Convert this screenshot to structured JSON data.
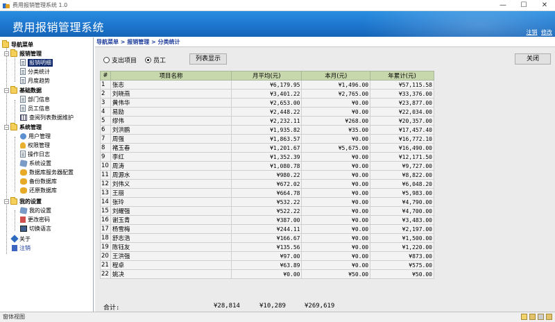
{
  "window": {
    "title": "费用报销管理系统 1.0",
    "controls": {
      "minimize": "—",
      "maximize": "☐",
      "close": "✕"
    }
  },
  "banner": {
    "title": "费用报销管理系统",
    "links": [
      "注销",
      "修改"
    ]
  },
  "sidebar": {
    "root": "导航菜单",
    "groups": [
      {
        "label": "报销管理",
        "items": [
          "报销明细",
          "分类统计",
          "月度趋势"
        ]
      },
      {
        "label": "基础数据",
        "items": [
          "部门信息",
          "员工信息",
          "查阅列表数据维护"
        ]
      },
      {
        "label": "系统管理",
        "items": [
          "用户管理",
          "权限管理",
          "操作日志",
          "系统设置",
          "数据库服务器配置",
          "备份数据库",
          "还原数据库"
        ]
      },
      {
        "label": "我的设置",
        "items": [
          "我的设置",
          "更改密码",
          "切换语言"
        ]
      }
    ],
    "about": "关于",
    "logout": "注销",
    "selected": "报销明细"
  },
  "breadcrumb": "导航菜单 > 报销管理 > 分类统计",
  "toolbar": {
    "radio_expense": "支出项目",
    "radio_employee": "员工",
    "list_button": "列表显示",
    "close_button": "关闭"
  },
  "table": {
    "headers": [
      "#",
      "项目名称",
      "月平均(元)",
      "本月(元)",
      "年累计(元)"
    ],
    "rows": [
      [
        "1",
        "张志",
        "¥6,179.95",
        "¥1,496.00",
        "¥57,115.58"
      ],
      [
        "2",
        "刘晓燕",
        "¥3,401.22",
        "¥2,765.00",
        "¥33,376.00"
      ],
      [
        "3",
        "黄伟华",
        "¥2,653.00",
        "¥0.00",
        "¥23,877.00"
      ],
      [
        "4",
        "易励",
        "¥2,448.22",
        "¥0.00",
        "¥22,034.00"
      ],
      [
        "5",
        "缪伟",
        "¥2,232.11",
        "¥268.00",
        "¥20,357.00"
      ],
      [
        "6",
        "刘洪鹏",
        "¥1,935.82",
        "¥35.00",
        "¥17,457.40"
      ],
      [
        "7",
        "周强",
        "¥1,863.57",
        "¥0.00",
        "¥16,772.10"
      ],
      [
        "8",
        "褚玉春",
        "¥1,201.67",
        "¥5,675.00",
        "¥16,490.00"
      ],
      [
        "9",
        "李红",
        "¥1,352.39",
        "¥0.00",
        "¥12,171.50"
      ],
      [
        "10",
        "周涛",
        "¥1,080.78",
        "¥0.00",
        "¥9,727.00"
      ],
      [
        "11",
        "周源水",
        "¥980.22",
        "¥0.00",
        "¥8,822.00"
      ],
      [
        "12",
        "刘伟义",
        "¥672.02",
        "¥0.00",
        "¥6,048.20"
      ],
      [
        "13",
        "王丽",
        "¥664.78",
        "¥0.00",
        "¥5,983.00"
      ],
      [
        "14",
        "张玲",
        "¥532.22",
        "¥0.00",
        "¥4,790.00"
      ],
      [
        "15",
        "刘耀强",
        "¥522.22",
        "¥0.00",
        "¥4,700.00"
      ],
      [
        "16",
        "谢玉青",
        "¥387.00",
        "¥0.00",
        "¥3,483.00"
      ],
      [
        "17",
        "杨雪梅",
        "¥244.11",
        "¥0.00",
        "¥2,197.00"
      ],
      [
        "18",
        "舒志浩",
        "¥166.67",
        "¥0.00",
        "¥1,500.00"
      ],
      [
        "19",
        "陈钰友",
        "¥135.56",
        "¥0.00",
        "¥1,220.00"
      ],
      [
        "20",
        "王洪强",
        "¥97.00",
        "¥0.00",
        "¥873.00"
      ],
      [
        "21",
        "程卓",
        "¥63.89",
        "¥0.00",
        "¥575.00"
      ],
      [
        "22",
        "姚决",
        "¥0.00",
        "¥50.00",
        "¥50.00"
      ]
    ]
  },
  "totals": {
    "label": "合计:",
    "monthly_avg": "¥28,814",
    "this_month": "¥10,289",
    "year_total": "¥269,619"
  },
  "statusbar": {
    "text": "窗体视图"
  }
}
